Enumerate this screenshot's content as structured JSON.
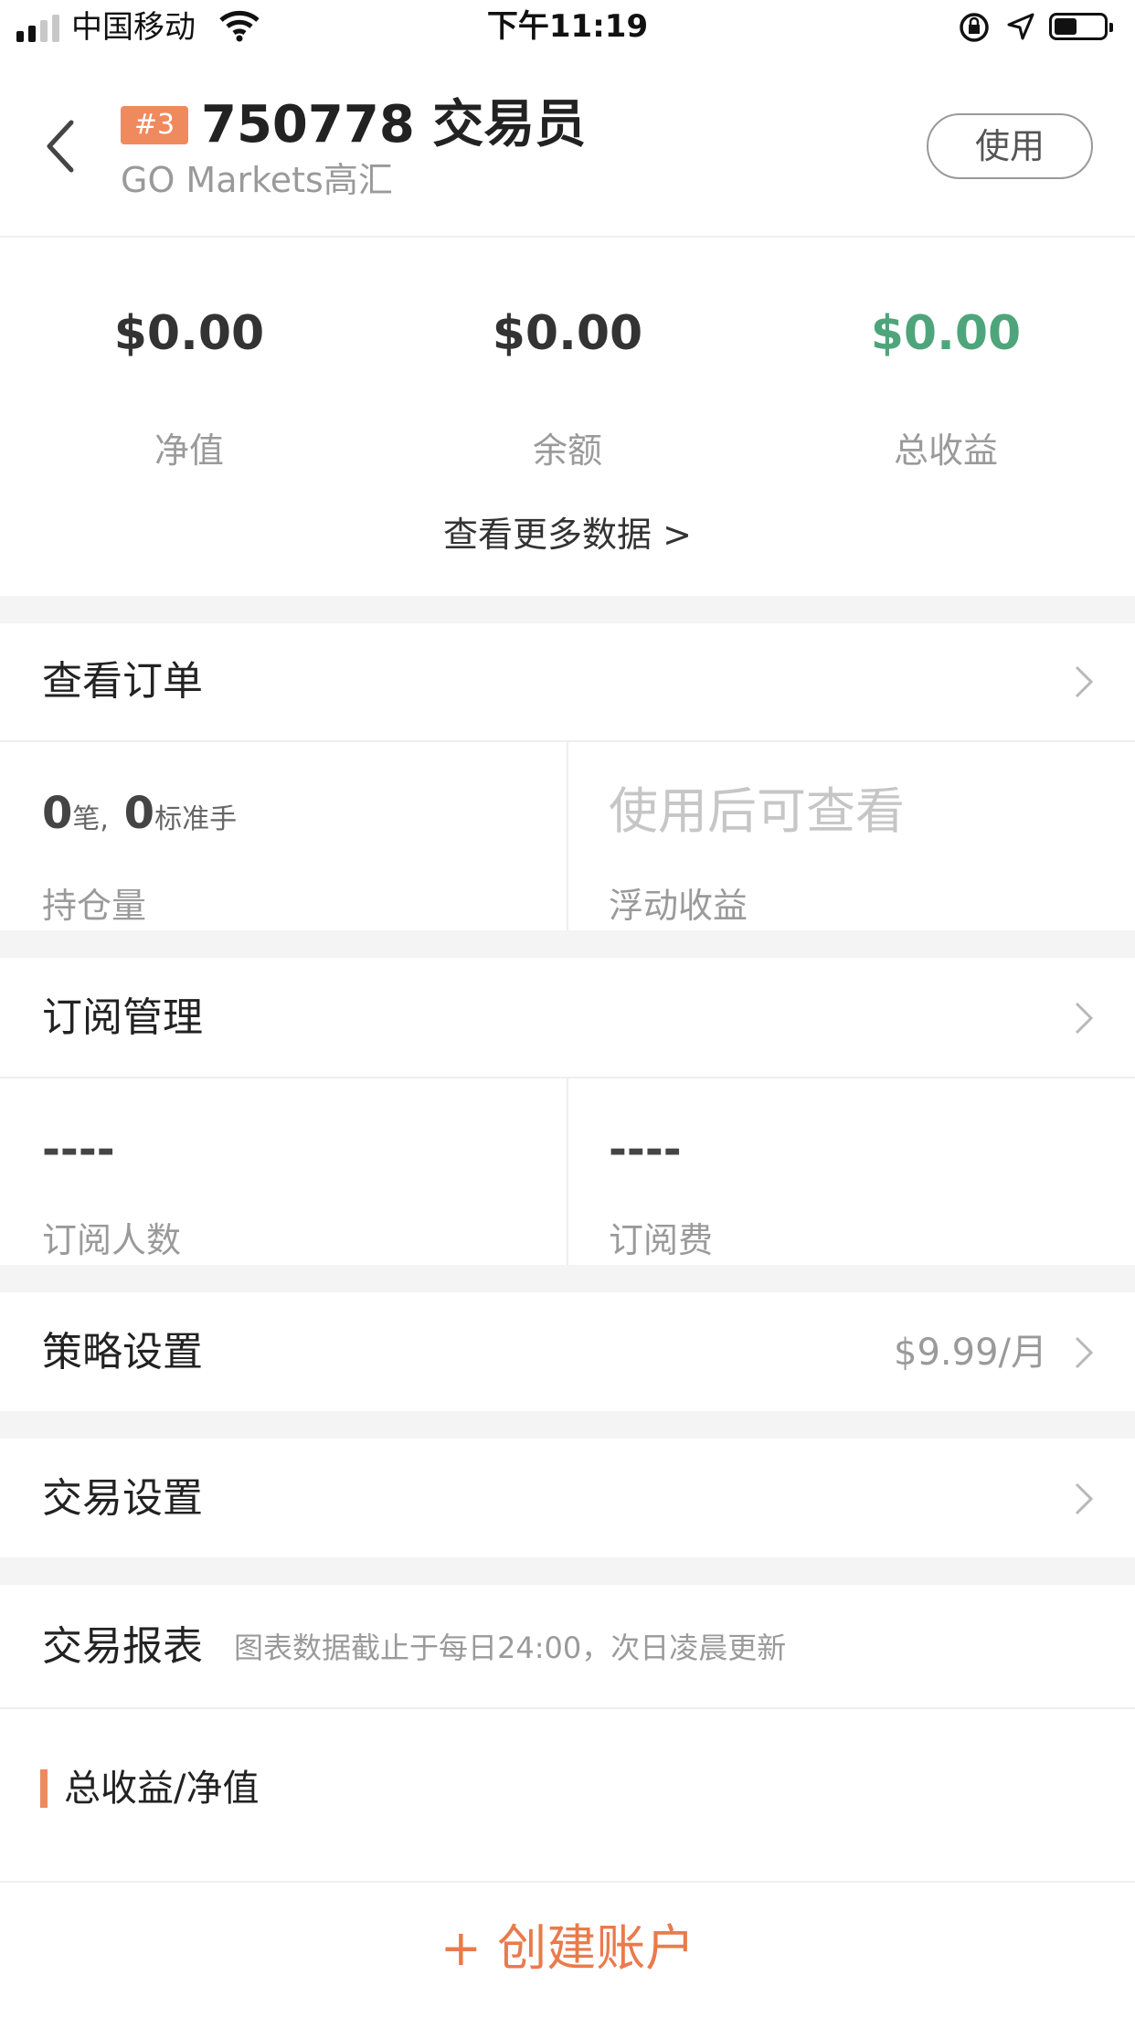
{
  "status_bar": {
    "carrier": "中国移动",
    "time": "下午11:19"
  },
  "header": {
    "badge": "#3",
    "title": "750778 交易员",
    "broker": "GO Markets高汇",
    "use_button": "使用"
  },
  "stats": [
    {
      "value": "$0.00",
      "label": "净值"
    },
    {
      "value": "$0.00",
      "label": "余额"
    },
    {
      "value": "$0.00",
      "label": "总收益"
    }
  ],
  "more_link": "查看更多数据 >",
  "orders": {
    "title": "查看订单",
    "positions_count": "0",
    "positions_unit1": "笔,",
    "positions_lots": "0",
    "positions_unit2": "标准手",
    "positions_label": "持仓量",
    "floating_value": "使用后可查看",
    "floating_label": "浮动收益"
  },
  "subscription": {
    "title": "订阅管理",
    "subscribers_value": "----",
    "subscribers_label": "订阅人数",
    "fee_value": "----",
    "fee_label": "订阅费"
  },
  "strategy": {
    "title": "策略设置",
    "price": "$9.99/月"
  },
  "trade_settings": {
    "title": "交易设置"
  },
  "report": {
    "title": "交易报表",
    "note": "图表数据截止于每日24:00，次日凌晨更新",
    "section": "总收益/净值"
  },
  "create_button": "+ 创建账户",
  "colors": {
    "accent": "#ef8a5e",
    "positive": "#4fa57b",
    "create": "#ea7a4c"
  }
}
